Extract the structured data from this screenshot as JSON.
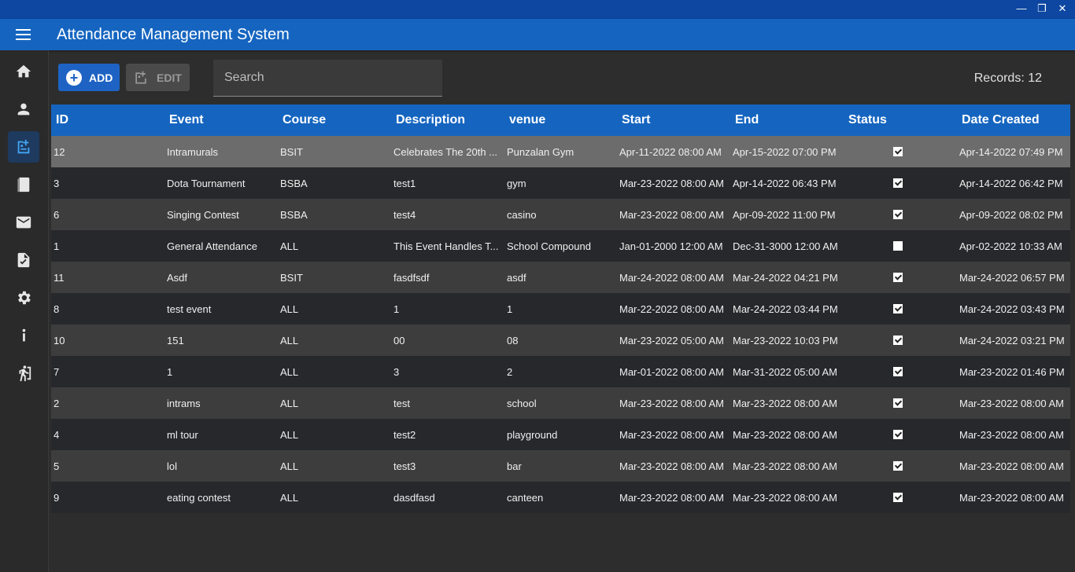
{
  "window": {
    "controls": [
      "minimize",
      "restore",
      "close"
    ]
  },
  "app": {
    "title": "Attendance Management System"
  },
  "sidebar": {
    "items": [
      {
        "name": "home",
        "icon": "home-icon"
      },
      {
        "name": "students",
        "icon": "person-icon"
      },
      {
        "name": "events",
        "icon": "event-icon",
        "active": true
      },
      {
        "name": "records",
        "icon": "book-icon"
      },
      {
        "name": "messages",
        "icon": "mail-icon"
      },
      {
        "name": "reports",
        "icon": "report-icon"
      },
      {
        "name": "settings",
        "icon": "gear-icon"
      },
      {
        "name": "about",
        "icon": "info-icon"
      },
      {
        "name": "logout",
        "icon": "exit-icon"
      }
    ]
  },
  "toolbar": {
    "add_label": "ADD",
    "edit_label": "EDIT",
    "search_placeholder": "Search",
    "records_text": "Records: 12"
  },
  "table": {
    "headers": [
      "ID",
      "Event",
      "Course",
      "Description",
      "venue",
      "Start",
      "End",
      "Status",
      "Date Created"
    ],
    "rows": [
      {
        "id": "12",
        "event": "Intramurals",
        "course": "BSIT",
        "description": "Celebrates The 20th ...",
        "venue": "Punzalan Gym",
        "start": "Apr-11-2022 08:00 AM",
        "end": "Apr-15-2022 07:00 PM",
        "status": true,
        "created": "Apr-14-2022 07:49 PM"
      },
      {
        "id": "3",
        "event": "Dota Tournament",
        "course": "BSBA",
        "description": "test1",
        "venue": "gym",
        "start": "Mar-23-2022 08:00 AM",
        "end": "Apr-14-2022 06:43 PM",
        "status": true,
        "created": "Apr-14-2022 06:42 PM"
      },
      {
        "id": "6",
        "event": "Singing Contest",
        "course": "BSBA",
        "description": "test4",
        "venue": "casino",
        "start": "Mar-23-2022 08:00 AM",
        "end": "Apr-09-2022 11:00 PM",
        "status": true,
        "created": "Apr-09-2022 08:02 PM"
      },
      {
        "id": "1",
        "event": "General Attendance",
        "course": "ALL",
        "description": "This Event Handles T...",
        "venue": "School Compound",
        "start": "Jan-01-2000 12:00 AM",
        "end": "Dec-31-3000 12:00 AM",
        "status": false,
        "created": "Apr-02-2022 10:33 AM"
      },
      {
        "id": "11",
        "event": "Asdf",
        "course": "BSIT",
        "description": "fasdfsdf",
        "venue": "asdf",
        "start": "Mar-24-2022 08:00 AM",
        "end": "Mar-24-2022 04:21 PM",
        "status": true,
        "created": "Mar-24-2022 06:57 PM"
      },
      {
        "id": "8",
        "event": "test event",
        "course": "ALL",
        "description": "1",
        "venue": "1",
        "start": "Mar-22-2022 08:00 AM",
        "end": "Mar-24-2022 03:44 PM",
        "status": true,
        "created": "Mar-24-2022 03:43 PM"
      },
      {
        "id": "10",
        "event": "151",
        "course": "ALL",
        "description": "00",
        "venue": "08",
        "start": "Mar-23-2022 05:00 AM",
        "end": "Mar-23-2022 10:03 PM",
        "status": true,
        "created": "Mar-24-2022 03:21 PM"
      },
      {
        "id": "7",
        "event": "1",
        "course": "ALL",
        "description": "3",
        "venue": "2",
        "start": "Mar-01-2022 08:00 AM",
        "end": "Mar-31-2022 05:00 AM",
        "status": true,
        "created": "Mar-23-2022 01:46 PM"
      },
      {
        "id": "2",
        "event": "intrams",
        "course": "ALL",
        "description": "test",
        "venue": "school",
        "start": "Mar-23-2022 08:00 AM",
        "end": "Mar-23-2022 08:00 AM",
        "status": true,
        "created": "Mar-23-2022 08:00 AM"
      },
      {
        "id": "4",
        "event": "ml tour",
        "course": "ALL",
        "description": "test2",
        "venue": "playground",
        "start": "Mar-23-2022 08:00 AM",
        "end": "Mar-23-2022 08:00 AM",
        "status": true,
        "created": "Mar-23-2022 08:00 AM"
      },
      {
        "id": "5",
        "event": "lol",
        "course": "ALL",
        "description": "test3",
        "venue": "bar",
        "start": "Mar-23-2022 08:00 AM",
        "end": "Mar-23-2022 08:00 AM",
        "status": true,
        "created": "Mar-23-2022 08:00 AM"
      },
      {
        "id": "9",
        "event": "eating contest",
        "course": "ALL",
        "description": "dasdfasd",
        "venue": "canteen",
        "start": "Mar-23-2022 08:00 AM",
        "end": "Mar-23-2022 08:00 AM",
        "status": true,
        "created": "Mar-23-2022 08:00 AM"
      }
    ]
  },
  "colors": {
    "titlebar": "#0d47a1",
    "appbar": "#1565c0",
    "accent": "#1e63c4",
    "background": "#2d2d2d"
  }
}
